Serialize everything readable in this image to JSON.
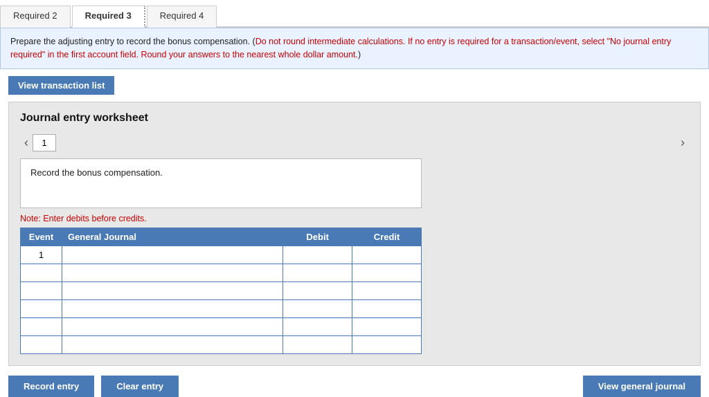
{
  "tabs": [
    {
      "id": "req2",
      "label": "Required 2",
      "active": false,
      "dotted": true
    },
    {
      "id": "req3",
      "label": "Required 3",
      "active": true,
      "dotted": true
    },
    {
      "id": "req4",
      "label": "Required 4",
      "active": false,
      "dotted": false
    }
  ],
  "instructions": {
    "main": "Prepare the adjusting entry to record the bonus compensation. (",
    "red": "Do not round intermediate calculations. If no entry is required for a transaction/event, select \"No journal entry required\" in the first account field. Round your answers to the nearest whole dollar amount.",
    "end": ")"
  },
  "view_transaction_btn": "View transaction list",
  "worksheet": {
    "title": "Journal entry worksheet",
    "nav_number": "1",
    "description": "Record the bonus compensation.",
    "note": "Note: Enter debits before credits.",
    "table": {
      "headers": [
        "Event",
        "General Journal",
        "Debit",
        "Credit"
      ],
      "rows": [
        {
          "event": "1",
          "journal": "",
          "debit": "",
          "credit": ""
        },
        {
          "event": "",
          "journal": "",
          "debit": "",
          "credit": ""
        },
        {
          "event": "",
          "journal": "",
          "debit": "",
          "credit": ""
        },
        {
          "event": "",
          "journal": "",
          "debit": "",
          "credit": ""
        },
        {
          "event": "",
          "journal": "",
          "debit": "",
          "credit": ""
        },
        {
          "event": "",
          "journal": "",
          "debit": "",
          "credit": ""
        }
      ]
    }
  },
  "buttons": {
    "record_entry": "Record entry",
    "clear_entry": "Clear entry",
    "view_general_journal": "View general journal"
  }
}
